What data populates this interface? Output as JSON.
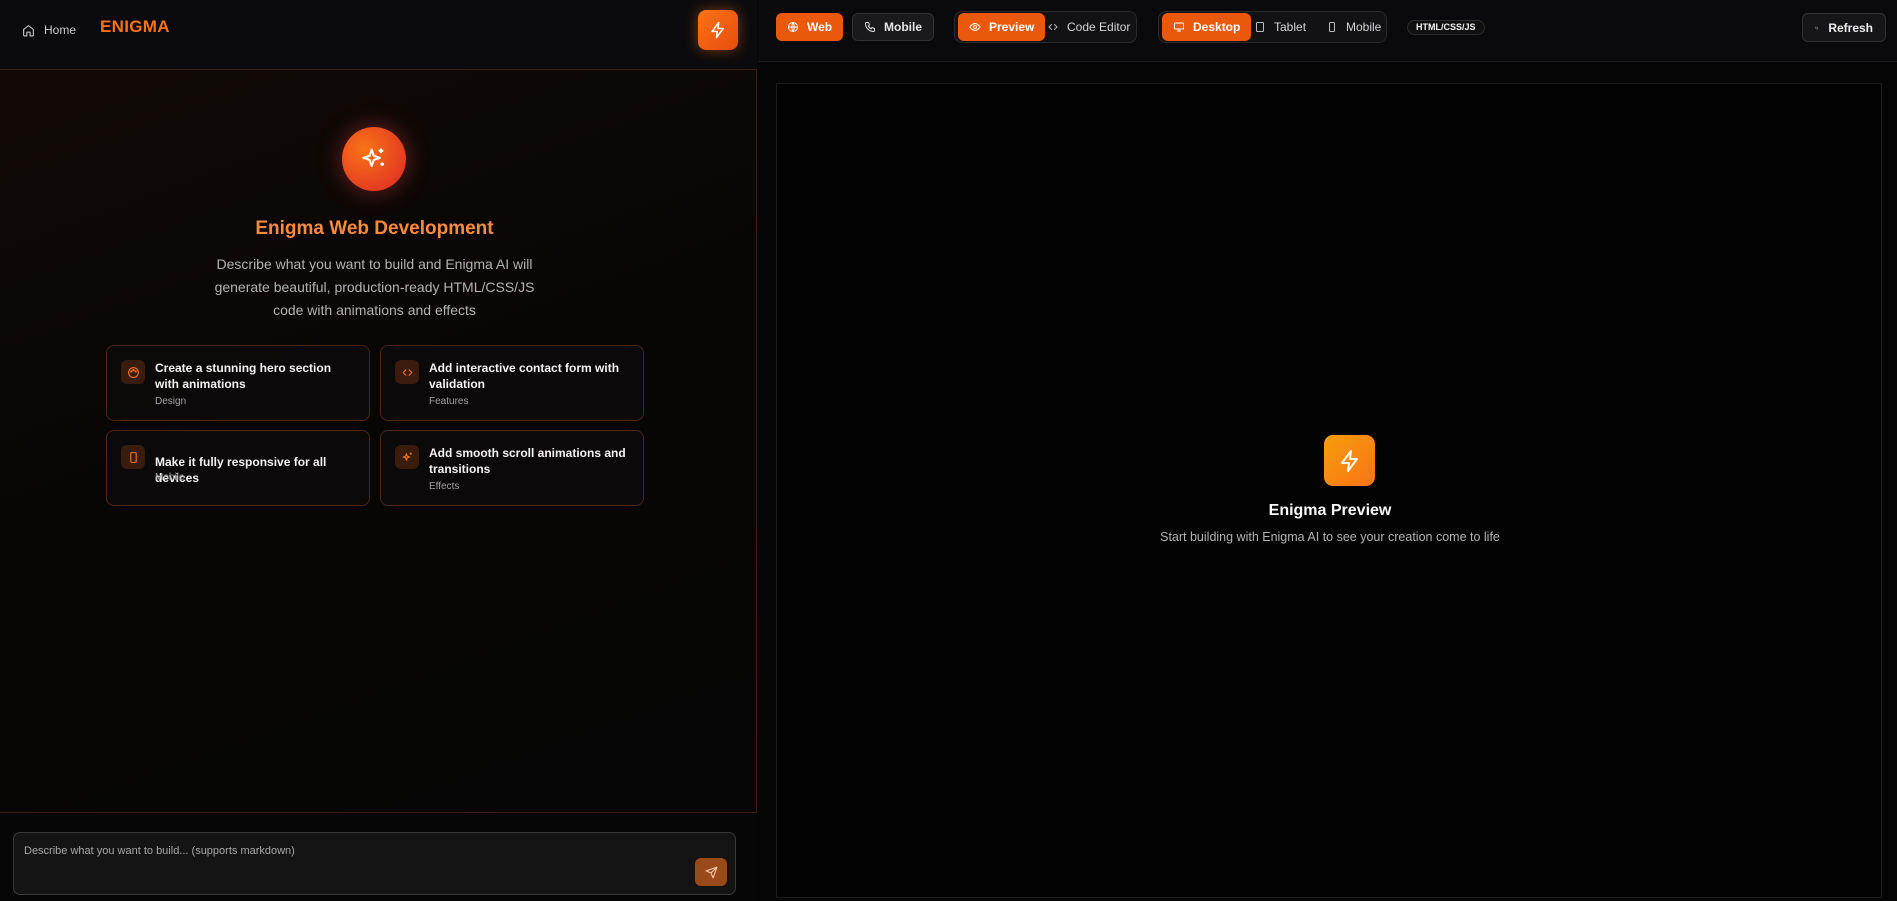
{
  "colors": {
    "accent": "#f97316",
    "accent_dark": "#ea580c",
    "background": "#050505"
  },
  "left_header": {
    "home_label": "Home",
    "brand": "ENIGMA",
    "bolt_icon": "zap-icon"
  },
  "hero": {
    "icon": "sparkles-icon",
    "title": "Enigma Web Development",
    "description": "Describe what you want to build and Enigma AI will generate beautiful, production-ready HTML/CSS/JS code with animations and effects"
  },
  "suggestions": [
    {
      "icon": "palette-icon",
      "title": "Create a stunning hero section with animations",
      "tag": "Design"
    },
    {
      "icon": "code-icon",
      "title": "Add interactive contact form with validation",
      "tag": "Features"
    },
    {
      "icon": "smartphone-icon",
      "title": "Make it fully responsive for all devices",
      "tag": "Mobile"
    },
    {
      "icon": "sparkles-icon",
      "title": "Add smooth scroll animations and transitions",
      "tag": "Effects"
    }
  ],
  "prompt": {
    "placeholder": "Describe what you want to build... (supports markdown)",
    "send_icon": "send-icon"
  },
  "toolbar": {
    "platform": {
      "web": "Web",
      "mobile": "Mobile",
      "selected": "Web"
    },
    "view": {
      "preview": "Preview",
      "code_editor": "Code Editor",
      "selected": "Preview"
    },
    "device": {
      "desktop": "Desktop",
      "tablet": "Tablet",
      "mobile": "Mobile",
      "selected": "Desktop"
    },
    "badge": "HTML/CSS/JS",
    "refresh": "Refresh"
  },
  "preview": {
    "icon": "zap-icon",
    "title": "Enigma Preview",
    "subtitle": "Start building with Enigma AI to see your creation come to life"
  }
}
